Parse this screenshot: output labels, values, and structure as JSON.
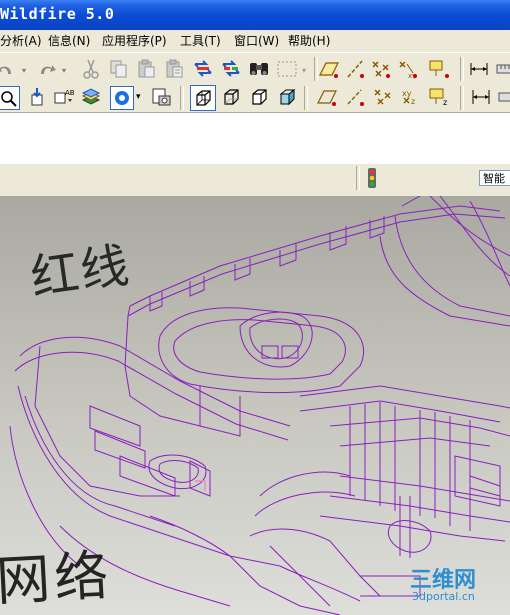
{
  "window": {
    "title": "Wildfire 5.0"
  },
  "menu": [
    {
      "label": "分析(A)"
    },
    {
      "label": "信息(N)"
    },
    {
      "label": "应用程序(P)"
    },
    {
      "label": "工具(T)"
    },
    {
      "label": "窗口(W)"
    },
    {
      "label": "帮助(H)"
    }
  ],
  "filter": {
    "value": "智能"
  },
  "annotations": {
    "line1": "红线",
    "line2": "网络"
  },
  "watermark": {
    "brand": "三维网",
    "url": "3dportal.cn"
  },
  "colors": {
    "titlebar": "#0a4ad4",
    "wire": "#8a1fbf",
    "viewport": "#bfbfb8"
  },
  "icons": {
    "toolbar1": [
      "undo-icon",
      "redo-icon",
      "cut-icon",
      "copy-icon",
      "paste-icon",
      "paste-special-icon",
      "regenerate-icon",
      "regenerate-manager-icon",
      "find-icon",
      "select-box-icon"
    ],
    "toolbar1_right": [
      "datum-plane-icon",
      "datum-axis-icon",
      "datum-point-icon",
      "datum-csys-icon",
      "annotation-icon",
      "measure-icon"
    ],
    "toolbar2": [
      "zoom-window-icon",
      "insert-feature-icon",
      "shape-icon",
      "layers-icon",
      "view-sphere-icon",
      "snapshot-icon",
      "wireframe-icon",
      "hidden-line-icon",
      "no-hidden-icon",
      "shaded-icon",
      "plane-display-icon",
      "axis-display-icon",
      "point-display-icon",
      "csys-display-icon",
      "note-display-icon",
      "scale-icon"
    ],
    "status": "traffic-light-icon"
  }
}
